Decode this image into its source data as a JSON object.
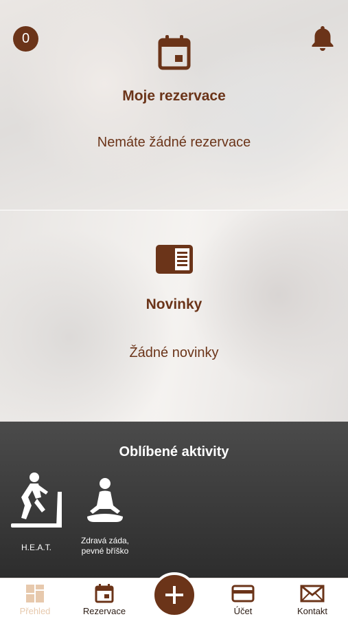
{
  "header": {
    "badge_count": "0",
    "notifications_icon": "bell-icon"
  },
  "reservations": {
    "icon": "calendar-icon",
    "title": "Moje rezervace",
    "empty_text": "Nemáte žádné rezervace"
  },
  "news": {
    "icon": "newspaper-icon",
    "title": "Novinky",
    "empty_text": "Žádné novinky"
  },
  "favorites": {
    "title": "Oblíbené aktivity",
    "items": [
      {
        "label": "H.E.A.T.",
        "icon": "treadmill-icon"
      },
      {
        "label": "Zdravá záda,\npevné bříško",
        "icon": "yoga-icon"
      }
    ]
  },
  "tabbar": {
    "items": [
      {
        "label": "Přehled",
        "icon": "dashboard-icon",
        "active": true
      },
      {
        "label": "Rezervace",
        "icon": "calendar-icon"
      },
      {
        "label": "Účet",
        "icon": "card-icon"
      },
      {
        "label": "Kontakt",
        "icon": "envelope-icon"
      }
    ],
    "center_button_icon": "plus-icon"
  },
  "colors": {
    "accent": "#6b3419",
    "active_tab": "#e7c9ad",
    "dark_section": "#3a3a3a"
  }
}
